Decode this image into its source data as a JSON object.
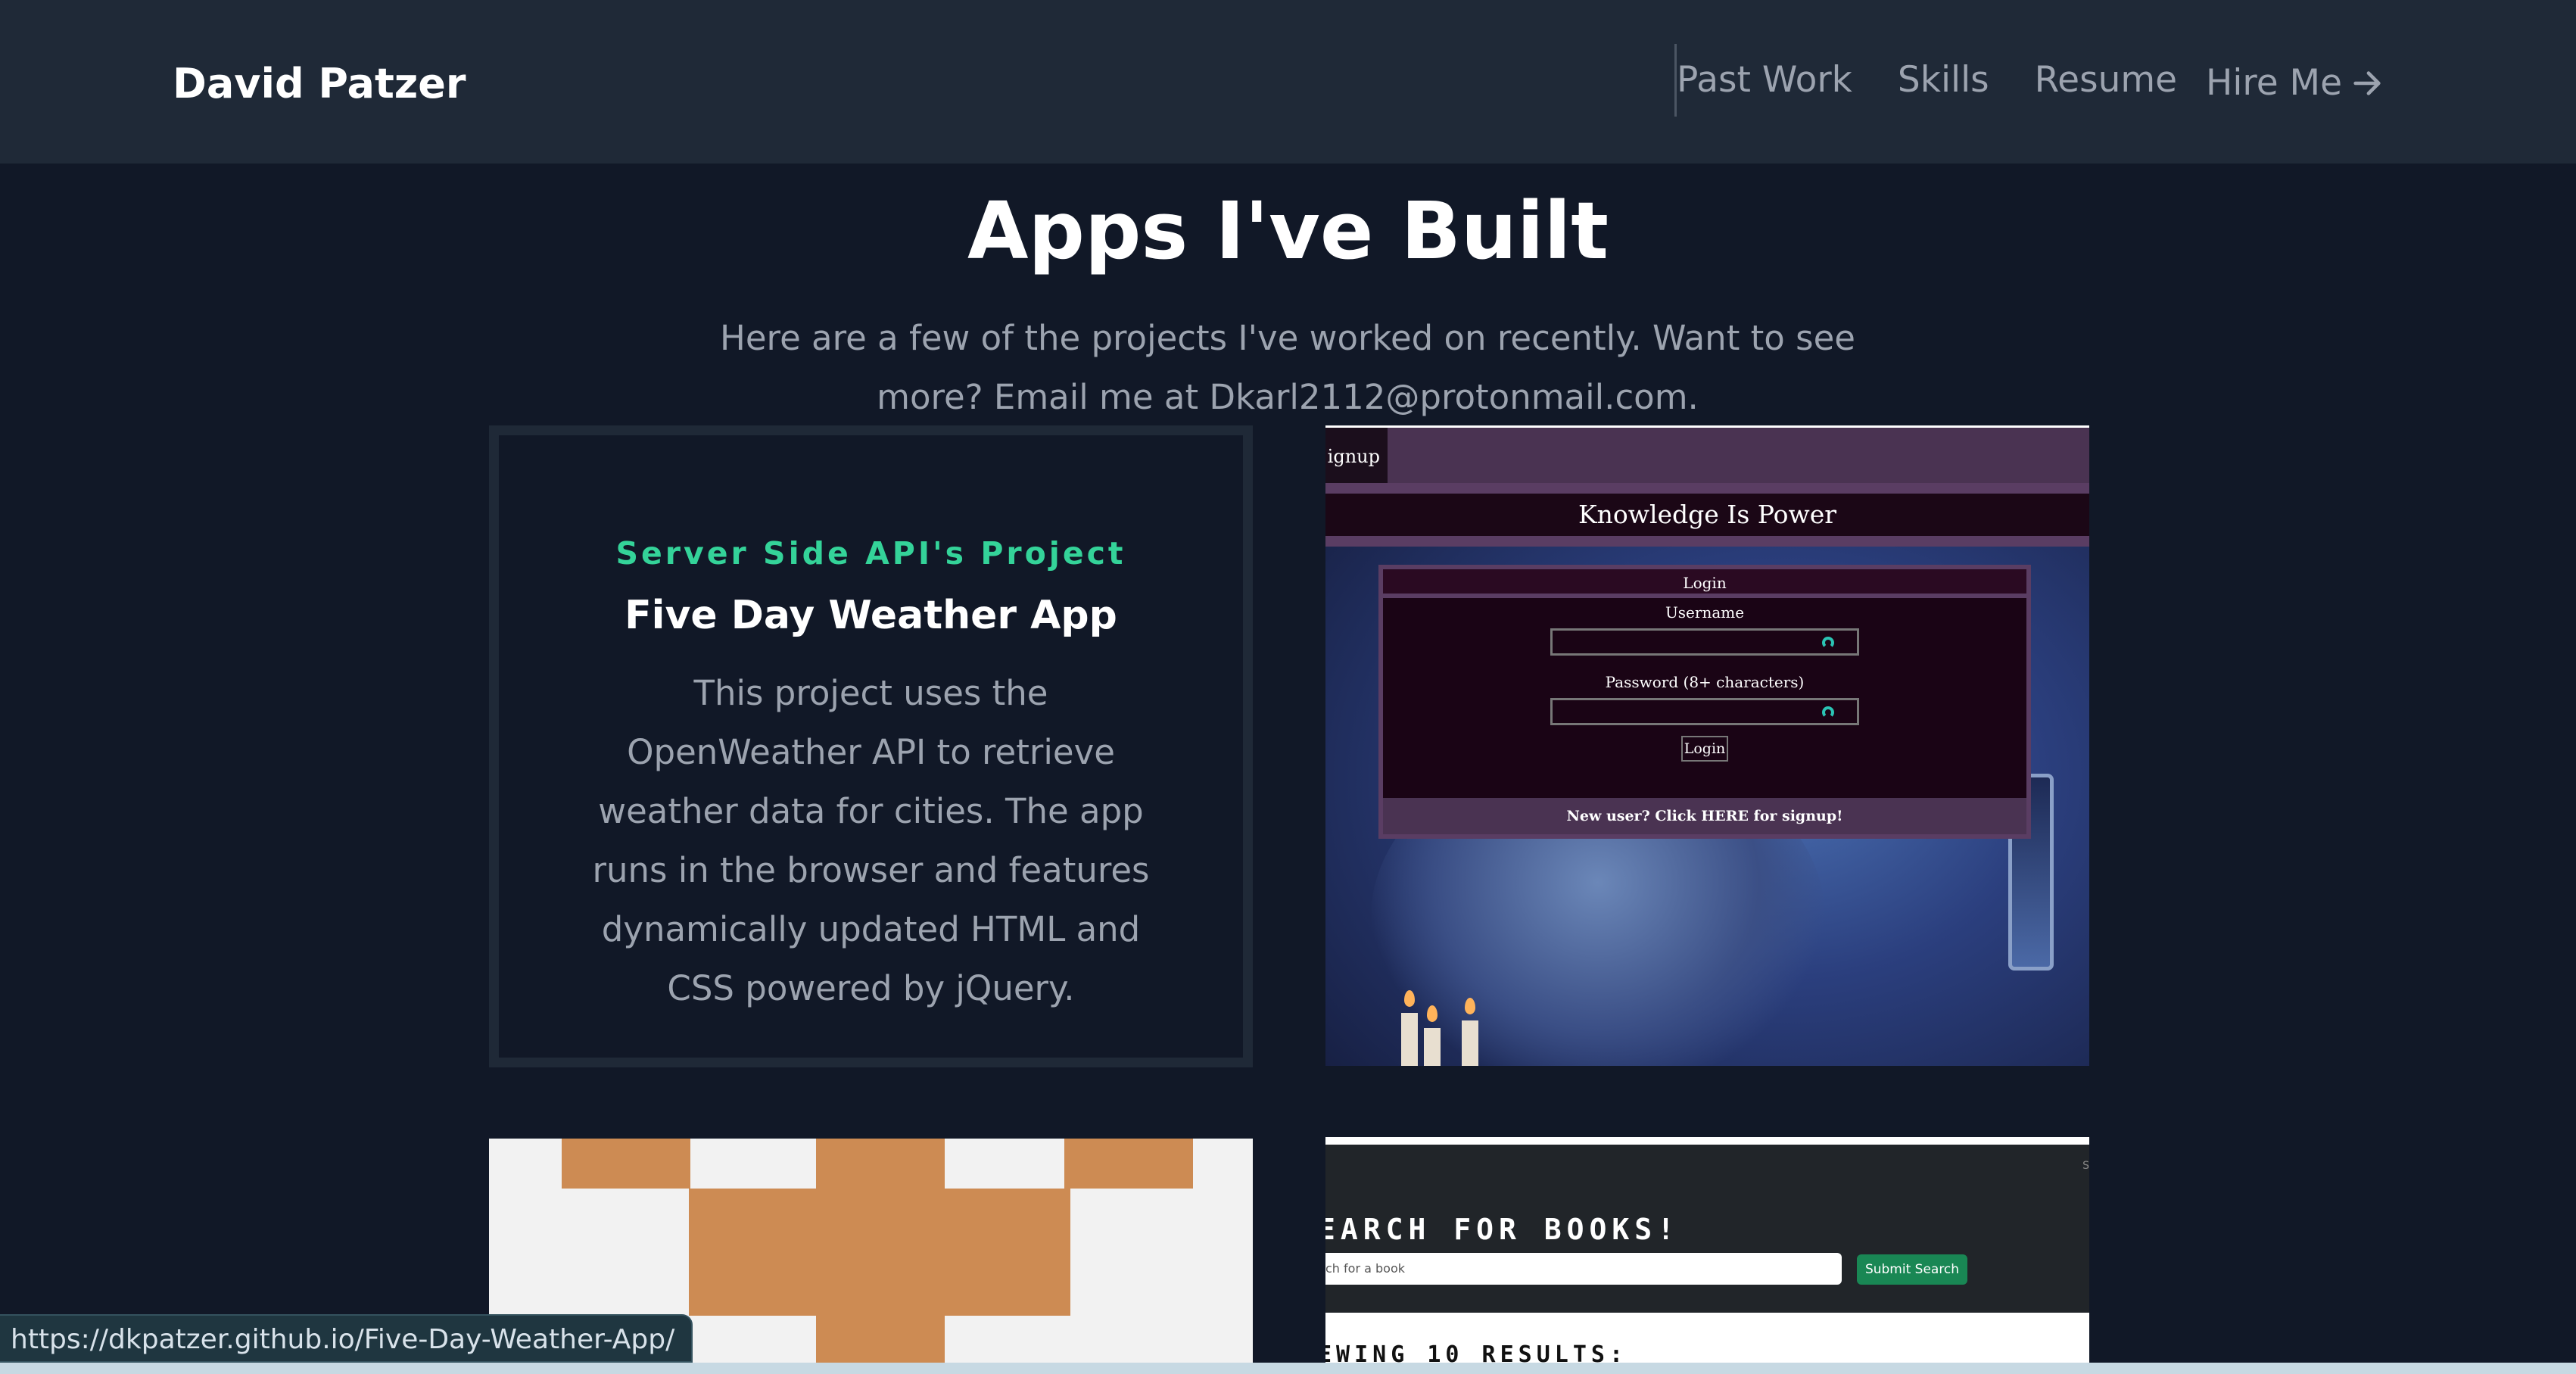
{
  "header": {
    "brand": "David Patzer",
    "nav": [
      "Past Work",
      "Skills",
      "Resume"
    ],
    "cta": "Hire Me"
  },
  "section": {
    "title": "Apps I've Built",
    "subtitle": "Here are a few of the projects I've worked on recently. Want to see more? Email me at Dkarl2112@protonmail.com."
  },
  "card": {
    "eyebrow": "Server Side API's Project",
    "title": "Five Day Weather App",
    "description": "This project uses the OpenWeather API to retrieve weather data for cities. The app runs in the browser and features dynamically updated HTML and CSS powered by jQuery."
  },
  "project_login": {
    "tab": "ignup",
    "heading": "Knowledge Is Power",
    "dialog_title": "Login",
    "username_label": "Username",
    "password_label": "Password (8+ characters)",
    "login_button": "Login",
    "signup_link": "New user? Click HERE for signup!"
  },
  "project_books": {
    "heading": "EARCH FOR BOOKS!",
    "input_placeholder": "ch for a book",
    "submit": "Submit Search",
    "results": "EWING 10 RESULTS:",
    "corner": "S"
  },
  "status_url": "https://dkpatzer.github.io/Five-Day-Weather-App/",
  "icons": {
    "hire_arrow": "arrow-right-icon"
  },
  "colors": {
    "bg": "#111827",
    "header": "#1f2937",
    "accent": "#34d399",
    "muted": "#9ca3af"
  }
}
